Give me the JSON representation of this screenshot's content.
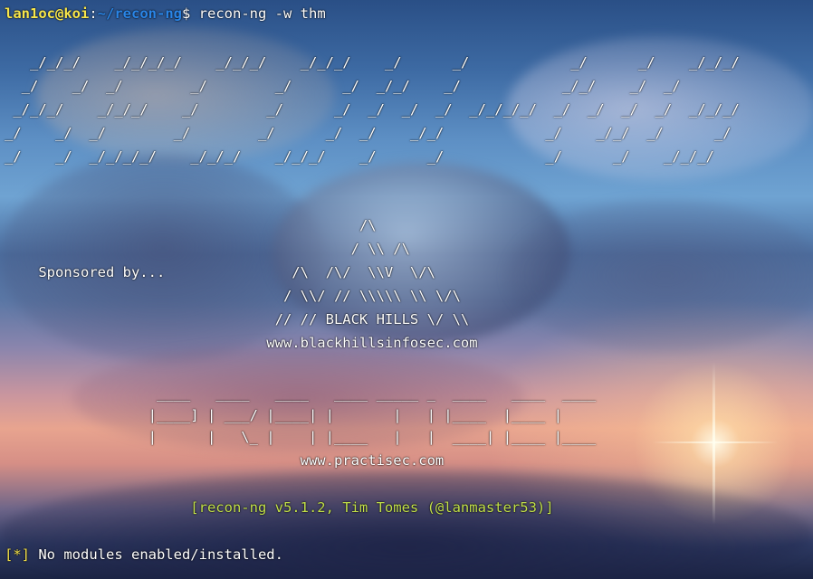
{
  "colors": {
    "prompt_user": "#f7e64b",
    "prompt_path": "#2a86e8",
    "version_line": "#c2e04a",
    "status_tag": "#f4e24a",
    "text": "#ffffff"
  },
  "prompt": {
    "user_host": "lan1oc@koi",
    "separator": ":",
    "path": "~/recon-ng",
    "dollar": "$ ",
    "command": "recon-ng -w thm"
  },
  "banner": {
    "ascii_lines": [
      "   _/_/_/    _/_/_/_/    _/_/_/    _/_/_/    _/      _/            _/      _/    _/_/_/",
      "  _/    _/  _/        _/        _/      _/  _/_/    _/            _/_/    _/  _/",
      " _/_/_/    _/_/_/    _/        _/      _/  _/  _/  _/  _/_/_/_/  _/  _/  _/  _/  _/_/_/",
      "_/    _/  _/        _/        _/      _/  _/    _/_/            _/    _/_/  _/      _/",
      "_/    _/  _/_/_/_/    _/_/_/    _/_/_/    _/      _/            _/      _/    _/_/_/"
    ]
  },
  "sponsor_bhis": {
    "label": "Sponsored by...",
    "ascii_lines": [
      "                                          /\\",
      "                                         / \\\\ /\\",
      "    Sponsored by...               /\\  /\\/  \\\\V  \\/\\",
      "                                 / \\\\/ // \\\\\\\\\\ \\\\ \\/\\",
      "                                // // BLACK HILLS \\/ \\\\",
      "                               www.blackhillsinfosec.com"
    ]
  },
  "sponsor_practisec": {
    "ascii_lines": [
      "                  ____   ____   ____   ____ _____ _  ____   ____  ____",
      "                 |____] | ___/ |____| |       |   | |____  |____ |",
      "                 |      |   \\_ |    | |____   |   |  ____| |____ |____",
      "                                   www.practisec.com"
    ]
  },
  "version_line": "                      [recon-ng v5.1.2, Tim Tomes (@lanmaster53)]",
  "status": {
    "tag": "[*]",
    "message": " No modules enabled/installed."
  }
}
